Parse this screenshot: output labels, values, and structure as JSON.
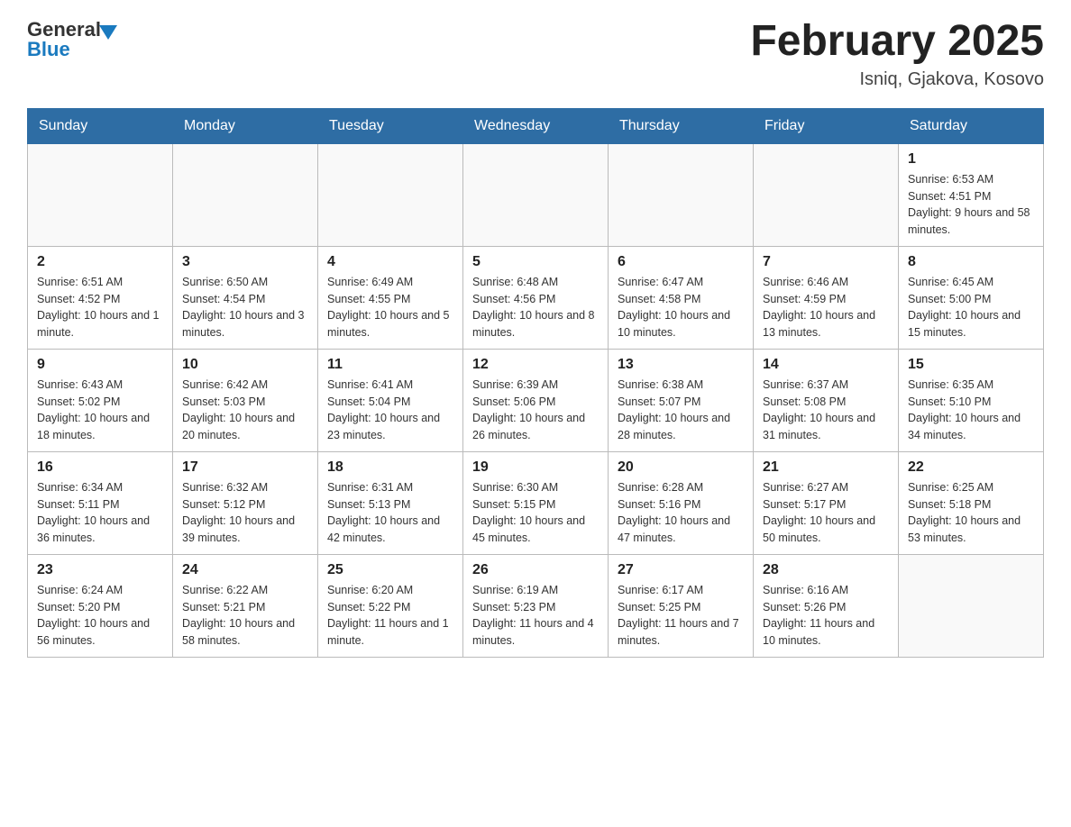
{
  "header": {
    "logo_general": "General",
    "logo_blue": "Blue",
    "month_title": "February 2025",
    "location": "Isniq, Gjakova, Kosovo"
  },
  "weekdays": [
    "Sunday",
    "Monday",
    "Tuesday",
    "Wednesday",
    "Thursday",
    "Friday",
    "Saturday"
  ],
  "weeks": [
    [
      {
        "day": "",
        "info": ""
      },
      {
        "day": "",
        "info": ""
      },
      {
        "day": "",
        "info": ""
      },
      {
        "day": "",
        "info": ""
      },
      {
        "day": "",
        "info": ""
      },
      {
        "day": "",
        "info": ""
      },
      {
        "day": "1",
        "info": "Sunrise: 6:53 AM\nSunset: 4:51 PM\nDaylight: 9 hours and 58 minutes."
      }
    ],
    [
      {
        "day": "2",
        "info": "Sunrise: 6:51 AM\nSunset: 4:52 PM\nDaylight: 10 hours and 1 minute."
      },
      {
        "day": "3",
        "info": "Sunrise: 6:50 AM\nSunset: 4:54 PM\nDaylight: 10 hours and 3 minutes."
      },
      {
        "day": "4",
        "info": "Sunrise: 6:49 AM\nSunset: 4:55 PM\nDaylight: 10 hours and 5 minutes."
      },
      {
        "day": "5",
        "info": "Sunrise: 6:48 AM\nSunset: 4:56 PM\nDaylight: 10 hours and 8 minutes."
      },
      {
        "day": "6",
        "info": "Sunrise: 6:47 AM\nSunset: 4:58 PM\nDaylight: 10 hours and 10 minutes."
      },
      {
        "day": "7",
        "info": "Sunrise: 6:46 AM\nSunset: 4:59 PM\nDaylight: 10 hours and 13 minutes."
      },
      {
        "day": "8",
        "info": "Sunrise: 6:45 AM\nSunset: 5:00 PM\nDaylight: 10 hours and 15 minutes."
      }
    ],
    [
      {
        "day": "9",
        "info": "Sunrise: 6:43 AM\nSunset: 5:02 PM\nDaylight: 10 hours and 18 minutes."
      },
      {
        "day": "10",
        "info": "Sunrise: 6:42 AM\nSunset: 5:03 PM\nDaylight: 10 hours and 20 minutes."
      },
      {
        "day": "11",
        "info": "Sunrise: 6:41 AM\nSunset: 5:04 PM\nDaylight: 10 hours and 23 minutes."
      },
      {
        "day": "12",
        "info": "Sunrise: 6:39 AM\nSunset: 5:06 PM\nDaylight: 10 hours and 26 minutes."
      },
      {
        "day": "13",
        "info": "Sunrise: 6:38 AM\nSunset: 5:07 PM\nDaylight: 10 hours and 28 minutes."
      },
      {
        "day": "14",
        "info": "Sunrise: 6:37 AM\nSunset: 5:08 PM\nDaylight: 10 hours and 31 minutes."
      },
      {
        "day": "15",
        "info": "Sunrise: 6:35 AM\nSunset: 5:10 PM\nDaylight: 10 hours and 34 minutes."
      }
    ],
    [
      {
        "day": "16",
        "info": "Sunrise: 6:34 AM\nSunset: 5:11 PM\nDaylight: 10 hours and 36 minutes."
      },
      {
        "day": "17",
        "info": "Sunrise: 6:32 AM\nSunset: 5:12 PM\nDaylight: 10 hours and 39 minutes."
      },
      {
        "day": "18",
        "info": "Sunrise: 6:31 AM\nSunset: 5:13 PM\nDaylight: 10 hours and 42 minutes."
      },
      {
        "day": "19",
        "info": "Sunrise: 6:30 AM\nSunset: 5:15 PM\nDaylight: 10 hours and 45 minutes."
      },
      {
        "day": "20",
        "info": "Sunrise: 6:28 AM\nSunset: 5:16 PM\nDaylight: 10 hours and 47 minutes."
      },
      {
        "day": "21",
        "info": "Sunrise: 6:27 AM\nSunset: 5:17 PM\nDaylight: 10 hours and 50 minutes."
      },
      {
        "day": "22",
        "info": "Sunrise: 6:25 AM\nSunset: 5:18 PM\nDaylight: 10 hours and 53 minutes."
      }
    ],
    [
      {
        "day": "23",
        "info": "Sunrise: 6:24 AM\nSunset: 5:20 PM\nDaylight: 10 hours and 56 minutes."
      },
      {
        "day": "24",
        "info": "Sunrise: 6:22 AM\nSunset: 5:21 PM\nDaylight: 10 hours and 58 minutes."
      },
      {
        "day": "25",
        "info": "Sunrise: 6:20 AM\nSunset: 5:22 PM\nDaylight: 11 hours and 1 minute."
      },
      {
        "day": "26",
        "info": "Sunrise: 6:19 AM\nSunset: 5:23 PM\nDaylight: 11 hours and 4 minutes."
      },
      {
        "day": "27",
        "info": "Sunrise: 6:17 AM\nSunset: 5:25 PM\nDaylight: 11 hours and 7 minutes."
      },
      {
        "day": "28",
        "info": "Sunrise: 6:16 AM\nSunset: 5:26 PM\nDaylight: 11 hours and 10 minutes."
      },
      {
        "day": "",
        "info": ""
      }
    ]
  ]
}
